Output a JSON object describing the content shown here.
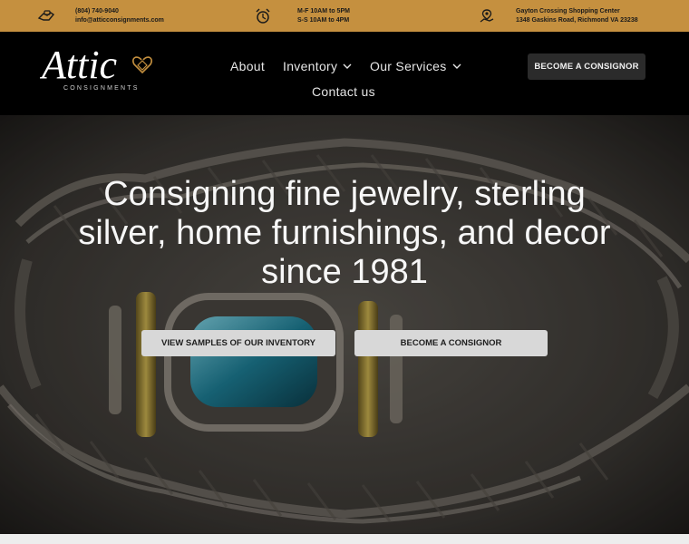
{
  "topbar": {
    "phone": "(804) 740-9040",
    "email": "info@atticconsignments.com",
    "hours_weekday": "M-F 10AM to 5PM",
    "hours_weekend": "S-S 10AM to 4PM",
    "location_name": "Gayton Crossing Shopping Center",
    "address": "1348 Gaskins Road, Richmond  VA 23238"
  },
  "logo": {
    "text": "Attic",
    "subtext": "CONSIGNMENTS"
  },
  "nav": {
    "about": "About",
    "inventory": "Inventory",
    "services": "Our Services",
    "contact": "Contact us",
    "cta": "BECOME A CONSIGNOR"
  },
  "hero": {
    "headline_line1": "Consigning fine jewelry, sterling",
    "headline_line2": "silver, home furnishings, and decor",
    "headline_line3": "since 1981",
    "btn_inventory": "VIEW SAMPLES OF OUR INVENTORY",
    "btn_consignor": "BECOME A CONSIGNOR"
  },
  "colors": {
    "topbar": "#c5903f",
    "nav": "#000000",
    "accent": "#c5903f"
  },
  "icons": [
    "phone-hand-icon",
    "alarm-clock-icon",
    "map-location-icon",
    "chevron-down-icon"
  ]
}
